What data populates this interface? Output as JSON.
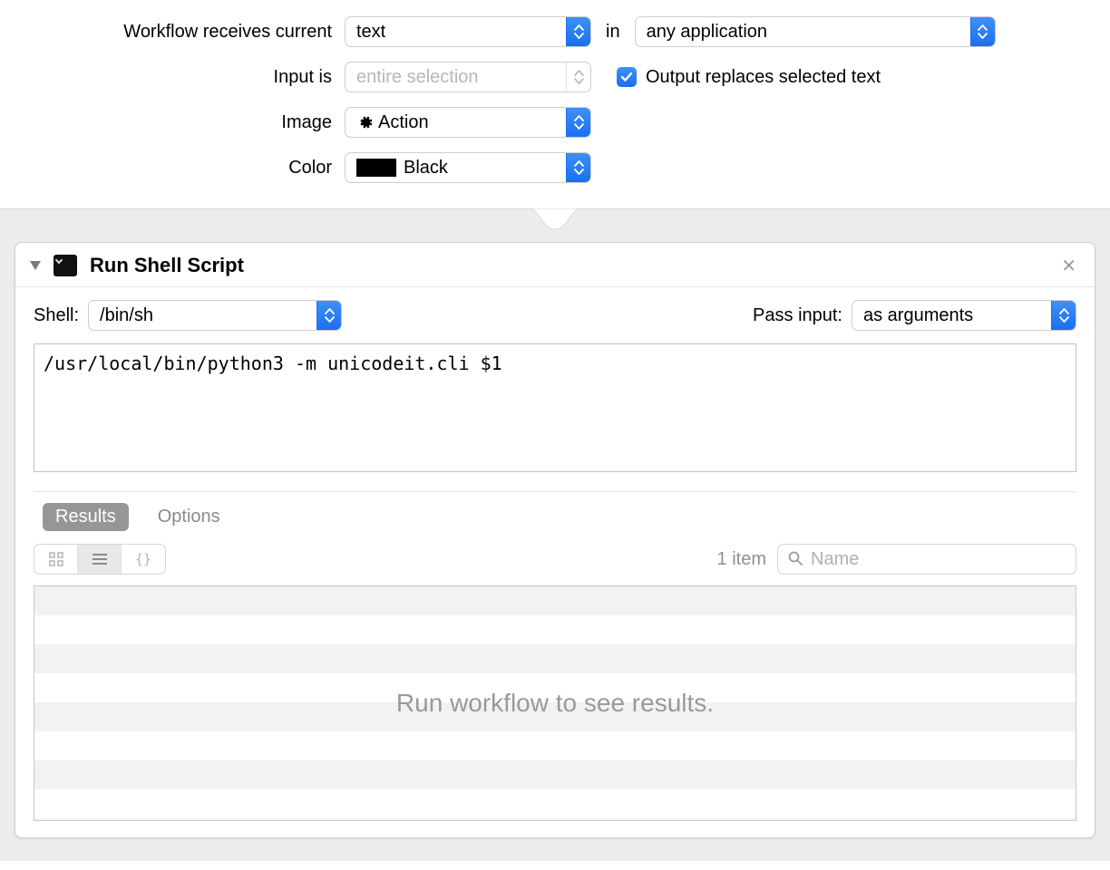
{
  "config": {
    "receives_label": "Workflow receives current",
    "receives_value": "text",
    "in_label": "in",
    "app_value": "any application",
    "input_is_label": "Input is",
    "input_is_value": "entire selection",
    "output_replaces_label": "Output replaces selected text",
    "output_replaces_checked": true,
    "image_label": "Image",
    "image_value": "Action",
    "color_label": "Color",
    "color_value": "Black"
  },
  "action": {
    "title": "Run Shell Script",
    "shell_label": "Shell:",
    "shell_value": "/bin/sh",
    "pass_input_label": "Pass input:",
    "pass_input_value": "as arguments",
    "script": "/usr/local/bin/python3 -m unicodeit.cli $1",
    "tabs": {
      "results": "Results",
      "options": "Options"
    },
    "results": {
      "item_count": "1 item",
      "search_placeholder": "Name",
      "placeholder": "Run workflow to see results."
    }
  }
}
